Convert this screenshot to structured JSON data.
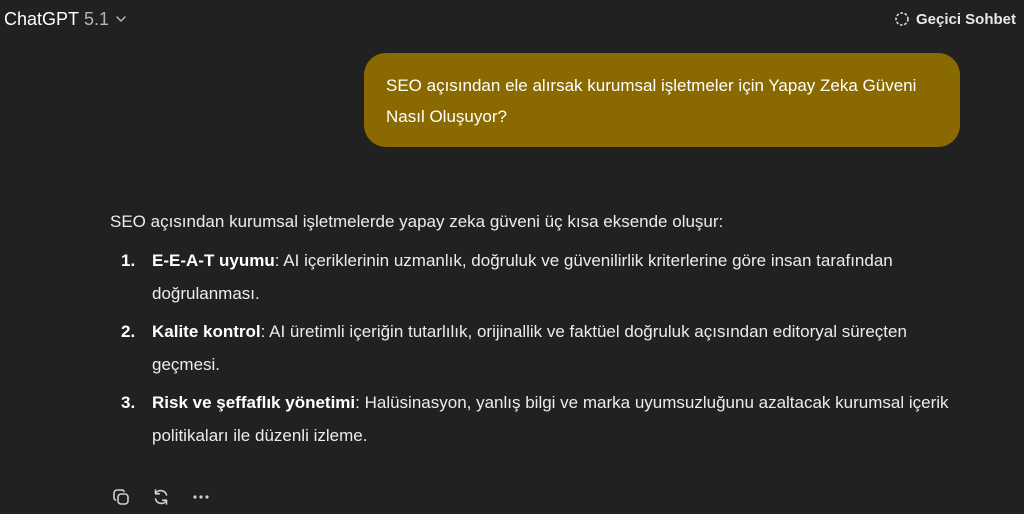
{
  "header": {
    "model_name": "ChatGPT",
    "model_version": "5.1",
    "temporary_chat_label": "Geçici Sohbet"
  },
  "user_message": "SEO açısından ele alırsak kurumsal işletmeler için Yapay Zeka Güveni Nasıl Oluşuyor?",
  "assistant_message": {
    "intro": "SEO açısından kurumsal işletmelerde yapay zeka güveni üç kısa eksende oluşur:",
    "points": [
      {
        "number": "1.",
        "title": "E-E-A-T uyumu",
        "text": ": AI içeriklerinin uzmanlık, doğruluk ve güvenilirlik kriterlerine göre insan tarafından doğrulanması."
      },
      {
        "number": "2.",
        "title": "Kalite kontrol",
        "text": ": AI üretimli içeriğin tutarlılık, orijinallik ve faktüel doğruluk açısından editoryal süreçten geçmesi."
      },
      {
        "number": "3.",
        "title": "Risk ve şeffaflık yönetimi",
        "text": ": Halüsinasyon, yanlış bilgi ve marka uyumsuzluğunu azaltacak kurumsal içerik politikaları ile düzenli izleme."
      }
    ]
  },
  "actions": {
    "copy_icon": "copy-icon",
    "regenerate_icon": "regenerate-icon",
    "more_icon": "more-icon"
  },
  "colors": {
    "background": "#212121",
    "user_bubble": "#8a6a00",
    "text": "#ececec"
  }
}
